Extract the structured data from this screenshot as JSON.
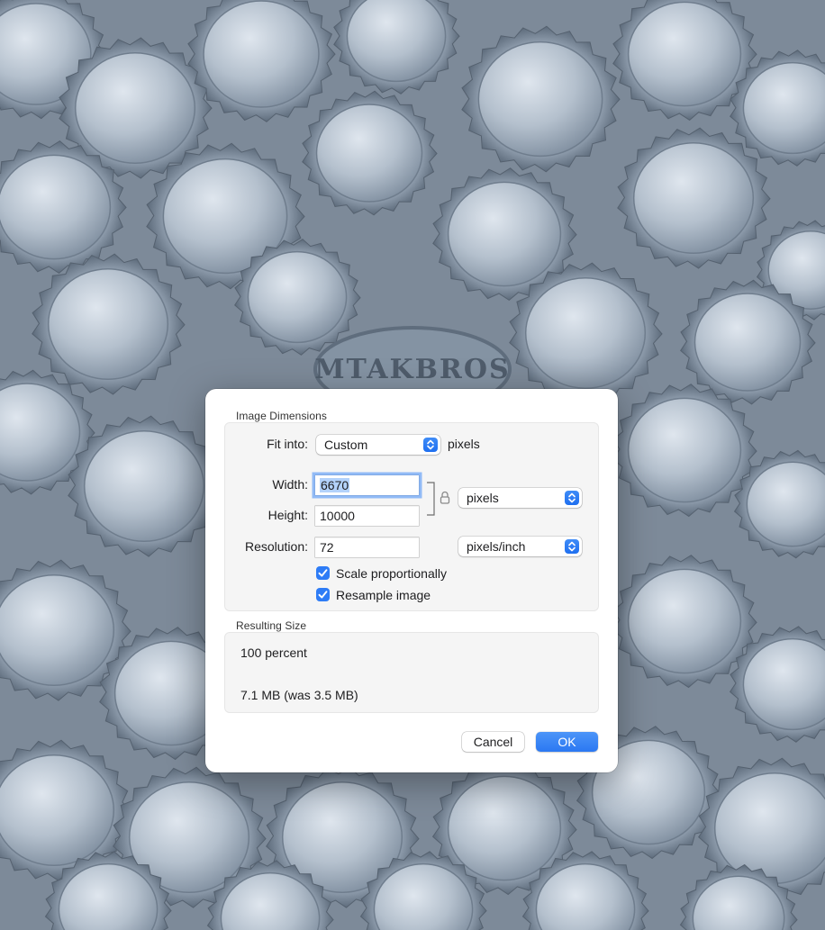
{
  "dialog": {
    "image_dimensions_label": "Image Dimensions",
    "fit_into": {
      "label": "Fit into:",
      "value": "Custom",
      "unit": "pixels"
    },
    "width": {
      "label": "Width:",
      "value": "6670"
    },
    "height": {
      "label": "Height:",
      "value": "10000"
    },
    "dimension_unit": "pixels",
    "resolution": {
      "label": "Resolution:",
      "value": "72",
      "unit": "pixels/inch"
    },
    "scale_proportionally": {
      "label": "Scale proportionally",
      "checked": true
    },
    "resample_image": {
      "label": "Resample image",
      "checked": true
    },
    "resulting_size_label": "Resulting Size",
    "result_percent": "100 percent",
    "result_size": "7.1 MB (was 3.5 MB)",
    "cancel_label": "Cancel",
    "ok_label": "OK"
  },
  "background": {
    "logo_text": "MTAKBROS"
  },
  "colors": {
    "accent": "#2e7cf6",
    "cap_tint": "#b7c2cf"
  },
  "icons": {
    "lock": "lock-icon",
    "chevrons": "chevron-updown-icon",
    "check": "checkmark-icon"
  }
}
